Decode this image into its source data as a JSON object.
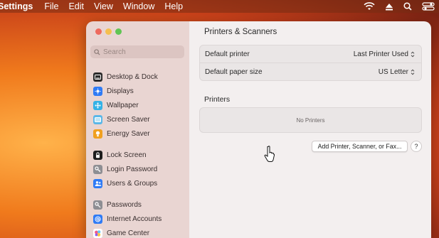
{
  "menubar": {
    "app": "Settings",
    "items": [
      "File",
      "Edit",
      "View",
      "Window",
      "Help"
    ],
    "icons": [
      "wifi-icon",
      "eject-icon",
      "search-icon",
      "control-center-icon"
    ]
  },
  "window": {
    "traffic_lights": [
      "close",
      "minimize",
      "zoom"
    ],
    "search": {
      "placeholder": "Search"
    },
    "sidebar": {
      "items": [
        {
          "label": "Desktop & Dock",
          "icon": "desktop-dock-icon",
          "color": "#2b2b2b"
        },
        {
          "label": "Displays",
          "icon": "displays-icon",
          "color": "#2f7bf5"
        },
        {
          "label": "Wallpaper",
          "icon": "wallpaper-icon",
          "color": "#34b2e6"
        },
        {
          "label": "Screen Saver",
          "icon": "screen-saver-icon",
          "color": "#5ab7e8"
        },
        {
          "label": "Energy Saver",
          "icon": "energy-saver-icon",
          "color": "#f0a020"
        },
        {
          "label": "Lock Screen",
          "icon": "lock-icon",
          "color": "#1d1d1d"
        },
        {
          "label": "Login Password",
          "icon": "key-icon",
          "color": "#8e8e93"
        },
        {
          "label": "Users & Groups",
          "icon": "users-icon",
          "color": "#2f7bf5"
        },
        {
          "label": "Passwords",
          "icon": "passwords-key-icon",
          "color": "#8e8e93"
        },
        {
          "label": "Internet Accounts",
          "icon": "at-icon",
          "color": "#2f7bf5"
        },
        {
          "label": "Game Center",
          "icon": "game-center-icon",
          "color": "#ffffff"
        }
      ]
    },
    "main": {
      "title": "Printers & Scanners",
      "settings": [
        {
          "label": "Default printer",
          "value": "Last Printer Used"
        },
        {
          "label": "Default paper size",
          "value": "US Letter"
        }
      ],
      "printers_heading": "Printers",
      "no_printers": "No Printers",
      "add_button": "Add Printer, Scanner, or Fax...",
      "help_button": "?"
    }
  }
}
